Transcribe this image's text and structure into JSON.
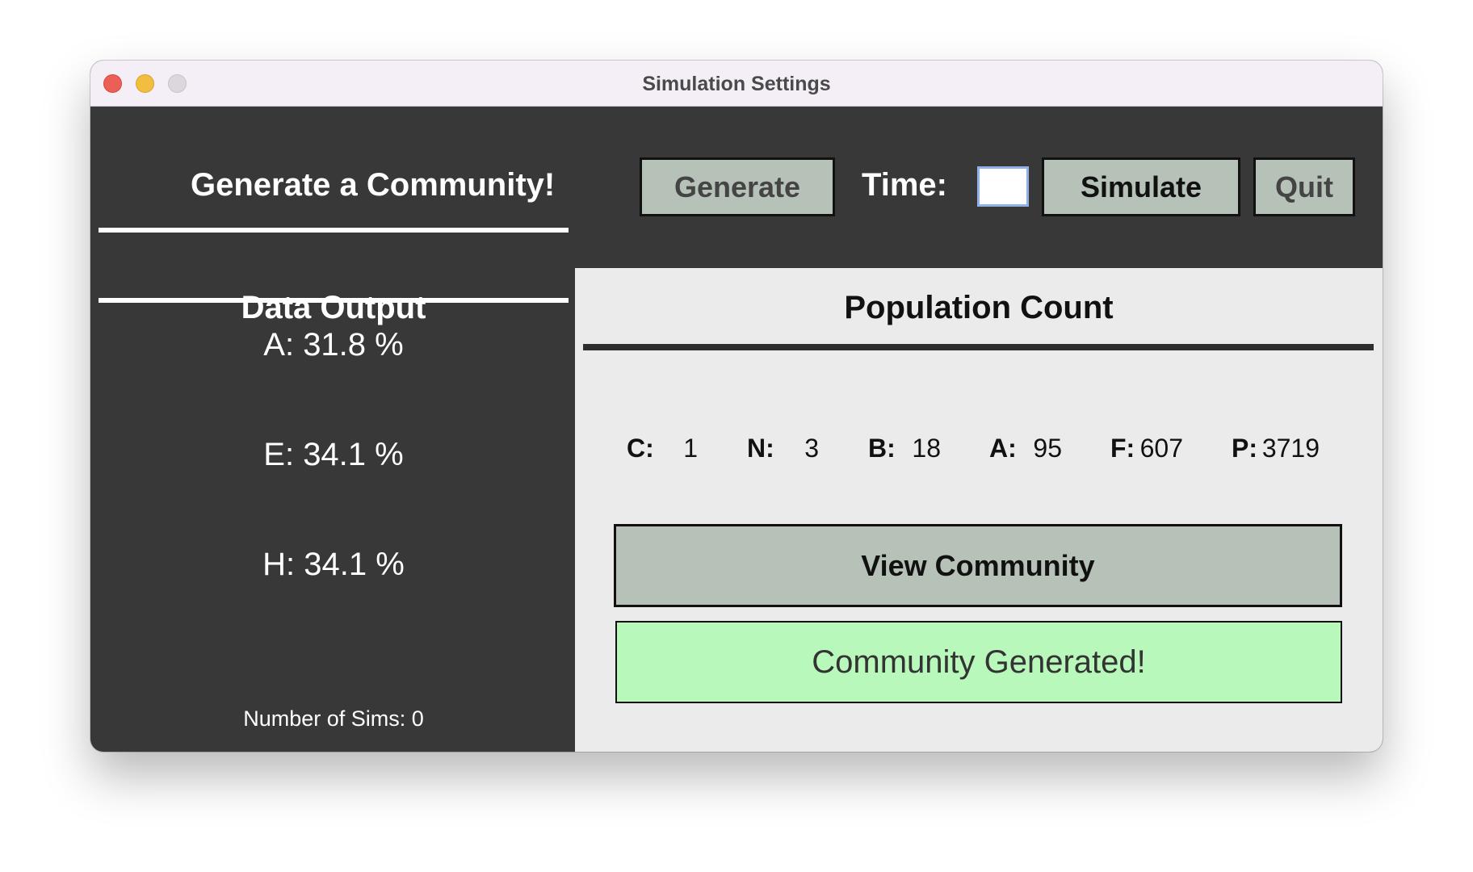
{
  "window": {
    "title": "Simulation Settings"
  },
  "toolbar": {
    "heading": "Generate a Community!",
    "generate_label": "Generate",
    "time_label": "Time:",
    "time_value": "",
    "simulate_label": "Simulate",
    "quit_label": "Quit"
  },
  "data_output": {
    "title": "Data Output",
    "stats": [
      {
        "label": "A: 31.8 %"
      },
      {
        "label": "E: 34.1 %"
      },
      {
        "label": "H: 34.1 %"
      }
    ],
    "sims_label": "Number of Sims: 0"
  },
  "population": {
    "title": "Population Count",
    "counts": [
      {
        "label": "C:",
        "value": "1"
      },
      {
        "label": "N:",
        "value": "3"
      },
      {
        "label": "B:",
        "value": "18"
      },
      {
        "label": "A:",
        "value": "95"
      },
      {
        "label": "F:",
        "value": "607"
      },
      {
        "label": "P:",
        "value": "3719"
      }
    ],
    "view_label": "View Community",
    "status": "Community Generated!"
  },
  "colors": {
    "window_bg": "#383838",
    "panel_bg": "#ebebeb",
    "button_bg": "#b6c2b8",
    "status_bg": "#b9f8bb",
    "input_border": "#8fb0e8"
  },
  "icons": [
    "close-window-icon",
    "minimize-window-icon",
    "zoom-window-icon"
  ]
}
